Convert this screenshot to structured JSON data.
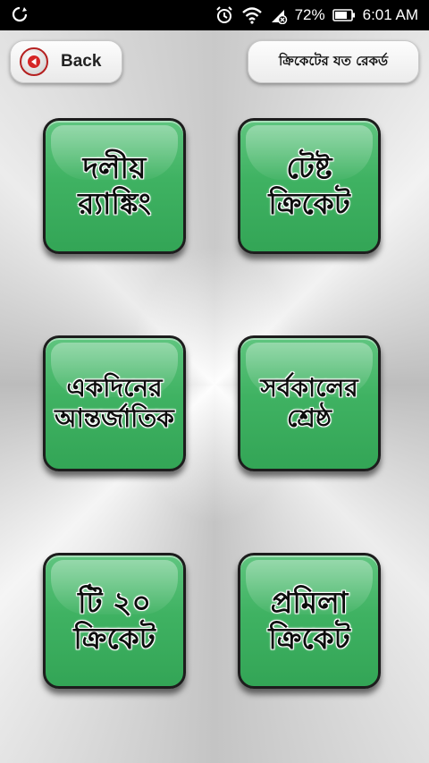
{
  "status_bar": {
    "battery_percent": "72%",
    "time": "6:01 AM",
    "icons": [
      "sync-icon",
      "alarm-icon",
      "wifi-icon",
      "signal-icon",
      "battery-icon"
    ]
  },
  "header": {
    "back_label": "Back",
    "title": "ক্রিকেটের যত রেকর্ড"
  },
  "tiles": [
    {
      "line1": "দলীয়",
      "line2": "র‍্যাঙ্কিং"
    },
    {
      "line1": "টেষ্ট",
      "line2": "ক্রিকেট"
    },
    {
      "line1": "একদিনের",
      "line2": "আন্তর্জাতিক"
    },
    {
      "line1": "সর্বকালের",
      "line2": "শ্রেষ্ঠ"
    },
    {
      "line1": "টি ২০",
      "line2": "ক্রিকেট"
    },
    {
      "line1": "প্রমিলা",
      "line2": "ক্রিকেট"
    }
  ],
  "colors": {
    "tile_green": "#3fb262",
    "back_red": "#d52626",
    "status_bar": "#000000"
  }
}
